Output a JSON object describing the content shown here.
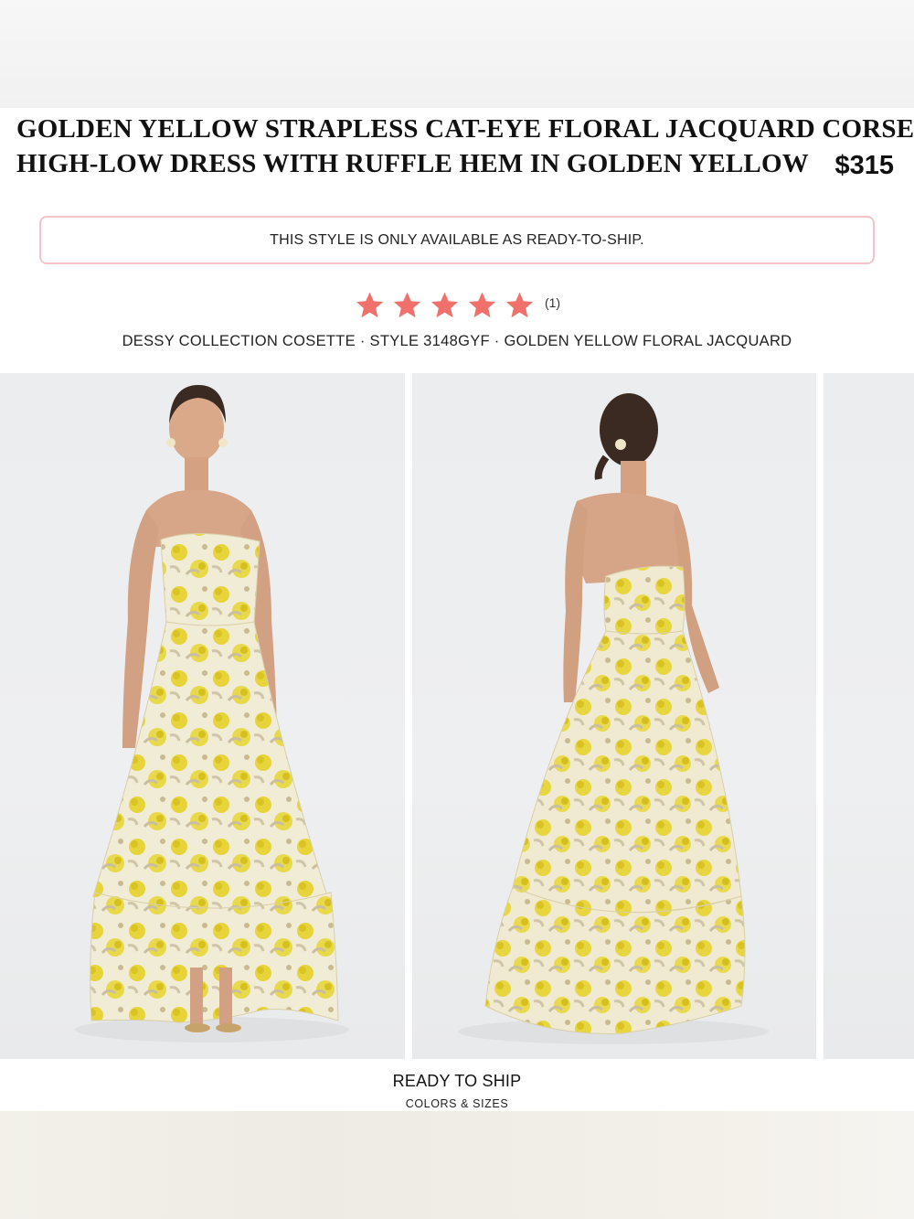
{
  "product": {
    "title_line1": "GOLDEN YELLOW STRAPLESS CAT-EYE FLORAL JACQUARD CORSET",
    "title_line2": "HIGH-LOW DRESS WITH RUFFLE HEM IN GOLDEN YELLOW",
    "price": "$315"
  },
  "notice": {
    "text": "THIS STYLE IS ONLY AVAILABLE AS READY-TO-SHIP."
  },
  "rating": {
    "stars": 5,
    "max_stars": 5,
    "count_label": "(1)",
    "star_color": "#f0716b"
  },
  "meta": {
    "text": "DESSY COLLECTION COSETTE · STYLE 3148GYF · GOLDEN YELLOW FLORAL JACQUARD"
  },
  "gallery": {
    "images": [
      {
        "alt": "front-view"
      },
      {
        "alt": "back-view"
      },
      {
        "alt": "next-image"
      }
    ],
    "dress_color": "#e8d94a",
    "fabric_base": "#f1ecd6"
  },
  "ready_to_ship": {
    "label": "READY TO SHIP",
    "sub_label": "COLORS & SIZES"
  }
}
